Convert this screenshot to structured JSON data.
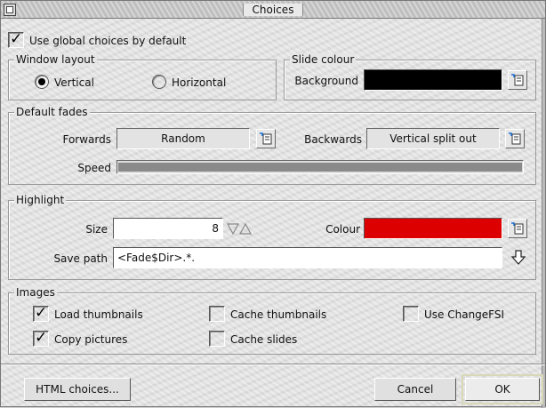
{
  "window": {
    "title": "Choices"
  },
  "global": {
    "label": "Use global choices by default",
    "checked": true
  },
  "window_layout": {
    "label": "Window layout",
    "options": [
      {
        "label": "Vertical",
        "selected": true
      },
      {
        "label": "Horizontal",
        "selected": false
      }
    ]
  },
  "slide_colour": {
    "label": "Slide colour",
    "background_label": "Background",
    "background_color": "#000000"
  },
  "default_fades": {
    "label": "Default fades",
    "forwards_label": "Forwards",
    "forwards_value": "Random",
    "backwards_label": "Backwards",
    "backwards_value": "Vertical split out",
    "speed_label": "Speed",
    "speed_fraction": 1.0
  },
  "highlight": {
    "label": "Highlight",
    "size_label": "Size",
    "size_value": "8",
    "colour_label": "Colour",
    "colour_color": "#dd0000",
    "save_path_label": "Save path",
    "save_path_value": "<Fade$Dir>.*."
  },
  "images": {
    "label": "Images",
    "load_thumbnails": {
      "label": "Load thumbnails",
      "checked": true
    },
    "cache_thumbnails": {
      "label": "Cache thumbnails",
      "checked": false
    },
    "use_changefsi": {
      "label": "Use ChangeFSI",
      "checked": false
    },
    "copy_pictures": {
      "label": "Copy pictures",
      "checked": true
    },
    "cache_slides": {
      "label": "Cache slides",
      "checked": false
    }
  },
  "buttons": {
    "html": "HTML choices...",
    "cancel": "Cancel",
    "ok": "OK"
  },
  "icons": {
    "back": "back-icon",
    "menu": "menu-icon",
    "spin": "spin-arrows-icon",
    "drop": "down-arrow-icon",
    "tick": "✓"
  }
}
